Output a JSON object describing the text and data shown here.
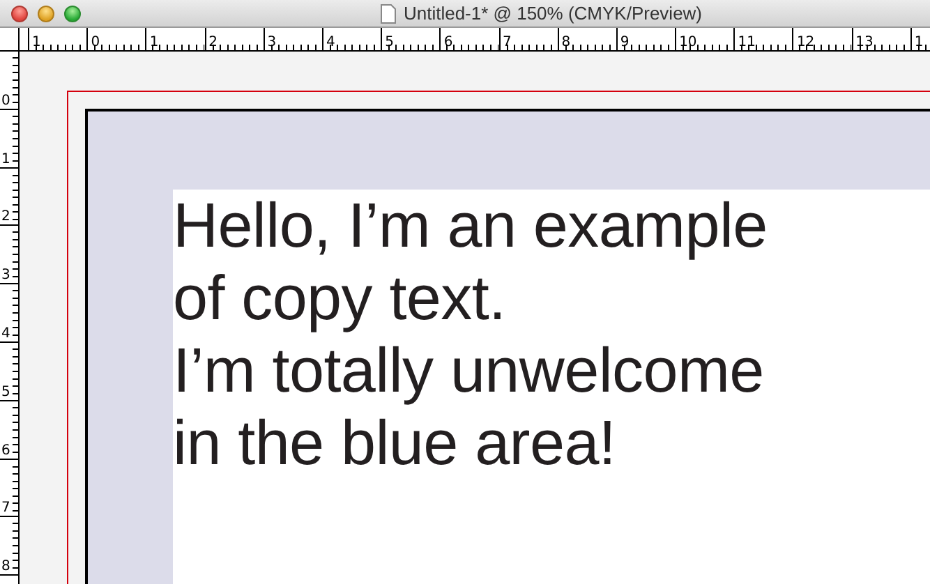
{
  "window": {
    "title": "Untitled-1* @ 150% (CMYK/Preview)"
  },
  "horizontal_ruler": {
    "labels": [
      "1",
      "0",
      "1",
      "2",
      "3",
      "4",
      "5",
      "6",
      "7",
      "8",
      "9",
      "10",
      "11",
      "12",
      "13",
      "1"
    ]
  },
  "vertical_ruler": {
    "labels": [
      "0",
      "1",
      "2",
      "3",
      "4",
      "5",
      "6",
      "7",
      "8"
    ]
  },
  "text_frame": {
    "text": "Hello, I’m an example\nof copy text.\nI’m totally unwelcome\nin the blue area!"
  }
}
